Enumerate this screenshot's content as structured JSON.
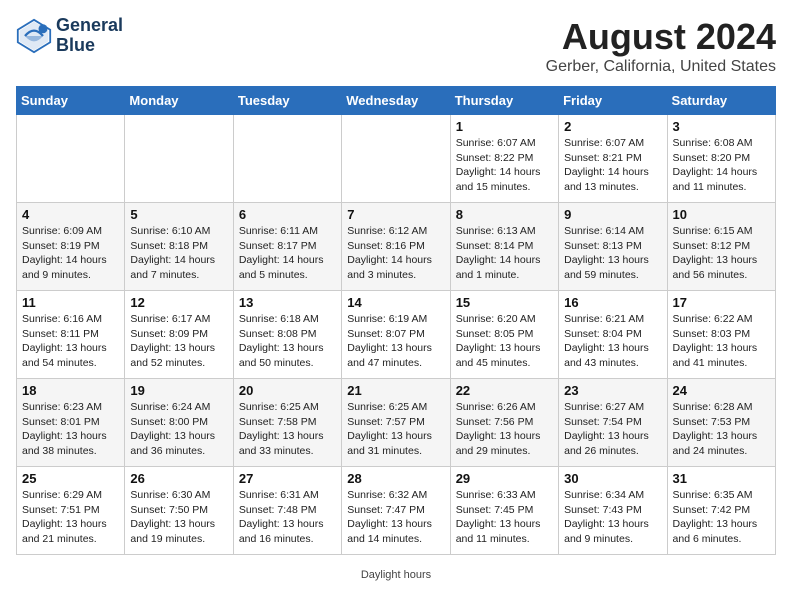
{
  "header": {
    "logo_line1": "General",
    "logo_line2": "Blue",
    "month_title": "August 2024",
    "location": "Gerber, California, United States"
  },
  "days_of_week": [
    "Sunday",
    "Monday",
    "Tuesday",
    "Wednesday",
    "Thursday",
    "Friday",
    "Saturday"
  ],
  "weeks": [
    [
      {
        "day": "",
        "info": ""
      },
      {
        "day": "",
        "info": ""
      },
      {
        "day": "",
        "info": ""
      },
      {
        "day": "",
        "info": ""
      },
      {
        "day": "1",
        "info": "Sunrise: 6:07 AM\nSunset: 8:22 PM\nDaylight: 14 hours\nand 15 minutes."
      },
      {
        "day": "2",
        "info": "Sunrise: 6:07 AM\nSunset: 8:21 PM\nDaylight: 14 hours\nand 13 minutes."
      },
      {
        "day": "3",
        "info": "Sunrise: 6:08 AM\nSunset: 8:20 PM\nDaylight: 14 hours\nand 11 minutes."
      }
    ],
    [
      {
        "day": "4",
        "info": "Sunrise: 6:09 AM\nSunset: 8:19 PM\nDaylight: 14 hours\nand 9 minutes."
      },
      {
        "day": "5",
        "info": "Sunrise: 6:10 AM\nSunset: 8:18 PM\nDaylight: 14 hours\nand 7 minutes."
      },
      {
        "day": "6",
        "info": "Sunrise: 6:11 AM\nSunset: 8:17 PM\nDaylight: 14 hours\nand 5 minutes."
      },
      {
        "day": "7",
        "info": "Sunrise: 6:12 AM\nSunset: 8:16 PM\nDaylight: 14 hours\nand 3 minutes."
      },
      {
        "day": "8",
        "info": "Sunrise: 6:13 AM\nSunset: 8:14 PM\nDaylight: 14 hours\nand 1 minute."
      },
      {
        "day": "9",
        "info": "Sunrise: 6:14 AM\nSunset: 8:13 PM\nDaylight: 13 hours\nand 59 minutes."
      },
      {
        "day": "10",
        "info": "Sunrise: 6:15 AM\nSunset: 8:12 PM\nDaylight: 13 hours\nand 56 minutes."
      }
    ],
    [
      {
        "day": "11",
        "info": "Sunrise: 6:16 AM\nSunset: 8:11 PM\nDaylight: 13 hours\nand 54 minutes."
      },
      {
        "day": "12",
        "info": "Sunrise: 6:17 AM\nSunset: 8:09 PM\nDaylight: 13 hours\nand 52 minutes."
      },
      {
        "day": "13",
        "info": "Sunrise: 6:18 AM\nSunset: 8:08 PM\nDaylight: 13 hours\nand 50 minutes."
      },
      {
        "day": "14",
        "info": "Sunrise: 6:19 AM\nSunset: 8:07 PM\nDaylight: 13 hours\nand 47 minutes."
      },
      {
        "day": "15",
        "info": "Sunrise: 6:20 AM\nSunset: 8:05 PM\nDaylight: 13 hours\nand 45 minutes."
      },
      {
        "day": "16",
        "info": "Sunrise: 6:21 AM\nSunset: 8:04 PM\nDaylight: 13 hours\nand 43 minutes."
      },
      {
        "day": "17",
        "info": "Sunrise: 6:22 AM\nSunset: 8:03 PM\nDaylight: 13 hours\nand 41 minutes."
      }
    ],
    [
      {
        "day": "18",
        "info": "Sunrise: 6:23 AM\nSunset: 8:01 PM\nDaylight: 13 hours\nand 38 minutes."
      },
      {
        "day": "19",
        "info": "Sunrise: 6:24 AM\nSunset: 8:00 PM\nDaylight: 13 hours\nand 36 minutes."
      },
      {
        "day": "20",
        "info": "Sunrise: 6:25 AM\nSunset: 7:58 PM\nDaylight: 13 hours\nand 33 minutes."
      },
      {
        "day": "21",
        "info": "Sunrise: 6:25 AM\nSunset: 7:57 PM\nDaylight: 13 hours\nand 31 minutes."
      },
      {
        "day": "22",
        "info": "Sunrise: 6:26 AM\nSunset: 7:56 PM\nDaylight: 13 hours\nand 29 minutes."
      },
      {
        "day": "23",
        "info": "Sunrise: 6:27 AM\nSunset: 7:54 PM\nDaylight: 13 hours\nand 26 minutes."
      },
      {
        "day": "24",
        "info": "Sunrise: 6:28 AM\nSunset: 7:53 PM\nDaylight: 13 hours\nand 24 minutes."
      }
    ],
    [
      {
        "day": "25",
        "info": "Sunrise: 6:29 AM\nSunset: 7:51 PM\nDaylight: 13 hours\nand 21 minutes."
      },
      {
        "day": "26",
        "info": "Sunrise: 6:30 AM\nSunset: 7:50 PM\nDaylight: 13 hours\nand 19 minutes."
      },
      {
        "day": "27",
        "info": "Sunrise: 6:31 AM\nSunset: 7:48 PM\nDaylight: 13 hours\nand 16 minutes."
      },
      {
        "day": "28",
        "info": "Sunrise: 6:32 AM\nSunset: 7:47 PM\nDaylight: 13 hours\nand 14 minutes."
      },
      {
        "day": "29",
        "info": "Sunrise: 6:33 AM\nSunset: 7:45 PM\nDaylight: 13 hours\nand 11 minutes."
      },
      {
        "day": "30",
        "info": "Sunrise: 6:34 AM\nSunset: 7:43 PM\nDaylight: 13 hours\nand 9 minutes."
      },
      {
        "day": "31",
        "info": "Sunrise: 6:35 AM\nSunset: 7:42 PM\nDaylight: 13 hours\nand 6 minutes."
      }
    ]
  ],
  "footer": {
    "daylight_note": "Daylight hours"
  }
}
